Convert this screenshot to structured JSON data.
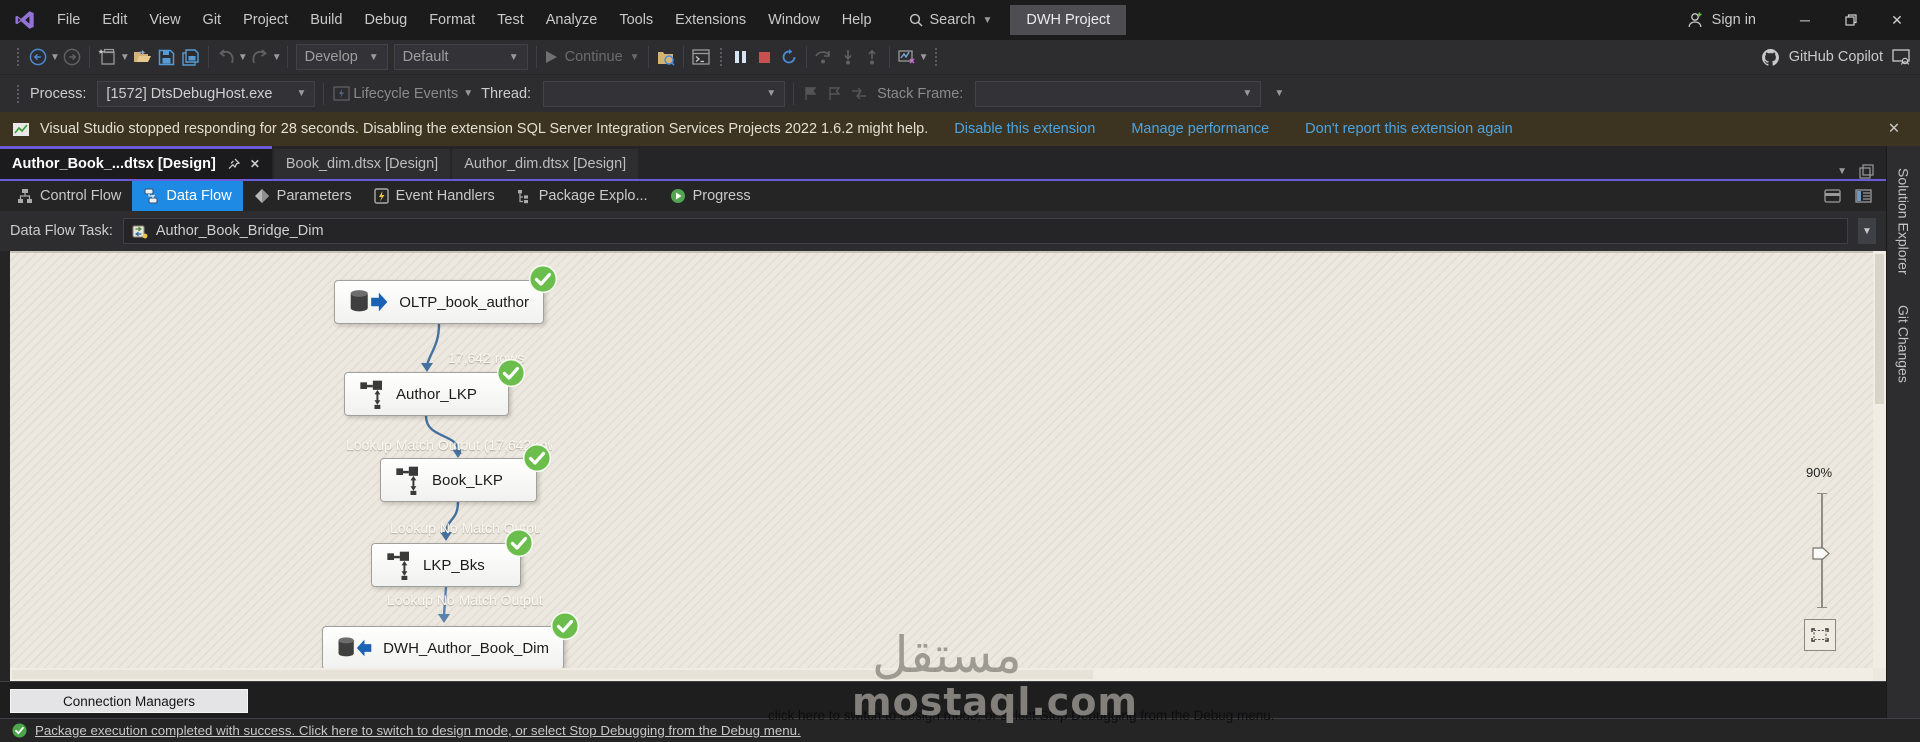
{
  "title_bar": {
    "menus": [
      "File",
      "Edit",
      "View",
      "Git",
      "Project",
      "Build",
      "Debug",
      "Format",
      "Test",
      "Analyze",
      "Tools",
      "Extensions",
      "Window",
      "Help"
    ],
    "search": "Search",
    "project": "DWH Project",
    "sign_in": "Sign in"
  },
  "toolbar": {
    "develop": "Develop",
    "default_config": "Default",
    "continue_label": "Continue",
    "copilot": "GitHub Copilot"
  },
  "debug_bar": {
    "process_label": "Process:",
    "process_value": "[1572] DtsDebugHost.exe",
    "lifecycle": "Lifecycle Events",
    "thread_label": "Thread:",
    "stack_label": "Stack Frame:"
  },
  "notification": {
    "message": "Visual Studio stopped responding for 28 seconds. Disabling the extension SQL Server Integration Services Projects 2022 1.6.2 might help.",
    "link_disable": "Disable this extension",
    "link_manage": "Manage performance",
    "link_dont": "Don't report this extension again"
  },
  "doc_tabs": {
    "tab0": "Author_Book_...dtsx [Design]",
    "tab1": "Book_dim.dtsx [Design]",
    "tab2": "Author_dim.dtsx [Design]"
  },
  "designer_tabs": {
    "control_flow": "Control Flow",
    "data_flow": "Data Flow",
    "parameters": "Parameters",
    "event_handlers": "Event Handlers",
    "package_explorer": "Package Explo...",
    "progress": "Progress"
  },
  "task_row": {
    "label": "Data Flow Task:",
    "value": "Author_Book_Bridge_Dim"
  },
  "diagram": {
    "node_source": "OLTP_book_author",
    "node_lkp1": "Author_LKP",
    "node_lkp2": "Book_LKP",
    "node_lkp3": "LKP_Bks",
    "node_dest": "DWH_Author_Book_Dim",
    "edge1": "17,642 rows",
    "edge2": "Lookup Match Output (17,642 rows)",
    "edge3": "Lookup No Match Output",
    "edge4": "Lookup No Match Output",
    "zoom": "90%"
  },
  "side_panel": {
    "tab1": "Solution Explorer",
    "tab2": "Git Changes"
  },
  "bottom": {
    "connection_managers": "Connection Managers",
    "status": "Package execution completed with success. Click here to switch to design mode, or select Stop Debugging from the Debug menu.",
    "watermark_echo": "click here to switch to design mode, or select Stop Debugging from the Debug menu.",
    "watermark_ar": "مستقل",
    "watermark_site": "mostaql.com"
  }
}
